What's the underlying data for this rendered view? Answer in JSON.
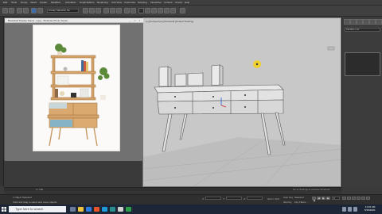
{
  "menubar": {
    "items": [
      "Edit",
      "Tools",
      "Group",
      "Views",
      "Create",
      "Modifiers",
      "Animation",
      "Graph Editors",
      "Rendering",
      "Civil View",
      "Customize",
      "Scripting",
      "Interactive",
      "Content",
      "Arnold",
      "Help"
    ]
  },
  "toolbar": {
    "selection_set": "Create Selection Se"
  },
  "photo_viewer": {
    "title": "Bookshelf Display Stand - 1.jpg - Windows Photo Viewer",
    "controls": [
      "_",
      "□",
      "×"
    ]
  },
  "viewport": {
    "label": "[+] [Perspective] [Standard] [Default Shading]"
  },
  "command_panel": {
    "dropdown": "Modifier List",
    "tabs": [
      "create-tab",
      "modify-tab",
      "hierarchy-tab",
      "motion-tab",
      "display-tab",
      "utilities-tab"
    ]
  },
  "timeline": {
    "frame": "0 / 100"
  },
  "status": {
    "selected": "1 Object Selected",
    "hint": "Click and drag to select and move objects",
    "x_label": "X:",
    "y_label": "Y:",
    "z_label": "Z:",
    "grid": "Grid = 10.0",
    "autokey": "Auto Key",
    "setkey": "Set Key",
    "selected_filter": "Selected",
    "key_filters": "Key Filters...",
    "frame_field": "0"
  },
  "activation": {
    "line1": "Activate Windows",
    "line2": "Go to Settings to activate Windows."
  },
  "taskbar": {
    "search_placeholder": "Type here to search",
    "time": "11:16 AM",
    "date": "5/15/2020",
    "accent": "#1c2636"
  }
}
